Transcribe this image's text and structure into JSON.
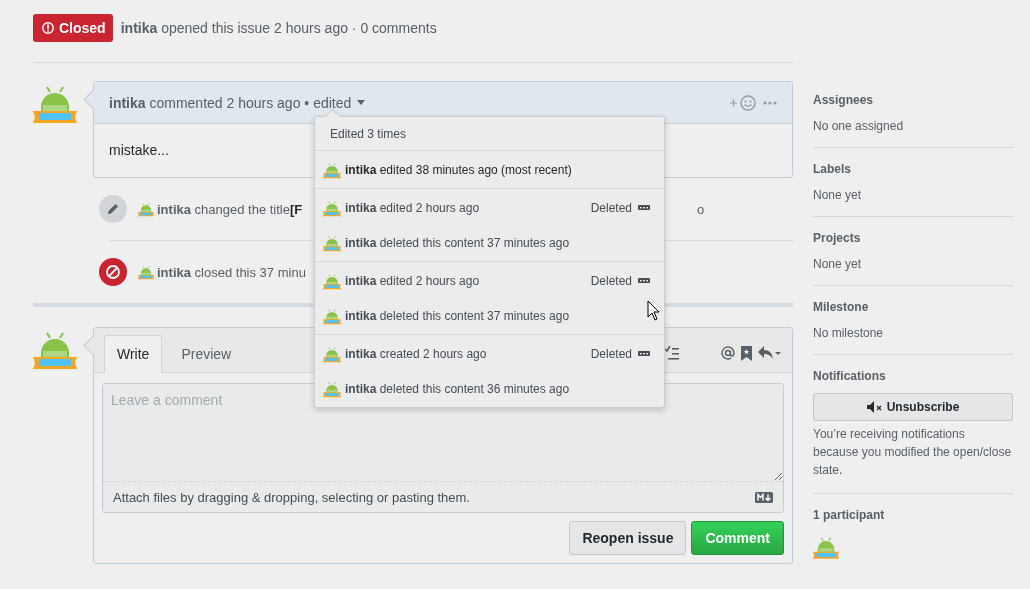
{
  "issue_header": {
    "state_badge": {
      "label": "Closed",
      "kind": "closed"
    },
    "author": "intika",
    "meta": "opened this issue 2 hours ago · 0 comments"
  },
  "comment": {
    "author": "intika",
    "meta": "commented 2 hours ago • edited",
    "body": "mistake...",
    "edit_history": {
      "title": "Edited 3 times",
      "groups": [
        {
          "entries": [
            {
              "author": "intika",
              "text": "edited 38 minutes ago (most recent)",
              "current": true
            }
          ]
        },
        {
          "entries": [
            {
              "author": "intika",
              "text": "edited 2 hours ago",
              "badge": "Deleted",
              "current": false
            },
            {
              "author": "intika",
              "text": "deleted this content 37 minutes ago",
              "current": false
            }
          ]
        },
        {
          "entries": [
            {
              "author": "intika",
              "text": "edited 2 hours ago",
              "badge": "Deleted",
              "current": false
            },
            {
              "author": "intika",
              "text": "deleted this content 37 minutes ago",
              "current": false
            }
          ]
        },
        {
          "entries": [
            {
              "author": "intika",
              "text": "created 2 hours ago",
              "badge": "Deleted",
              "current": false
            },
            {
              "author": "intika",
              "text": "deleted this content 36 minutes ago",
              "current": false
            }
          ]
        }
      ]
    }
  },
  "timeline": [
    {
      "kind": "renamed",
      "author": "intika",
      "text": "changed the title",
      "title_fragment": "[F",
      "tail": "o"
    },
    {
      "kind": "closed",
      "author": "intika",
      "text": "closed this 37 minu"
    }
  ],
  "composer": {
    "tabs": [
      {
        "label": "Write",
        "selected": true
      },
      {
        "label": "Preview",
        "selected": false
      }
    ],
    "placeholder": "Leave a comment",
    "attach_hint": "Attach files by dragging & dropping, selecting or pasting them.",
    "buttons": [
      {
        "label": "Reopen issue",
        "kind": "secondary"
      },
      {
        "label": "Comment",
        "kind": "primary"
      }
    ]
  },
  "sidebar": {
    "sections": [
      {
        "kind": "text",
        "title": "Assignees",
        "value": "No one assigned"
      },
      {
        "kind": "text",
        "title": "Labels",
        "value": "None yet"
      },
      {
        "kind": "text",
        "title": "Projects",
        "value": "None yet"
      },
      {
        "kind": "text",
        "title": "Milestone",
        "value": "No milestone"
      },
      {
        "kind": "notifications",
        "title": "Notifications",
        "button": "Unsubscribe",
        "note": "You’re receiving notifications because you modified the open/close state."
      },
      {
        "kind": "participants",
        "title": "1 participant"
      }
    ]
  }
}
